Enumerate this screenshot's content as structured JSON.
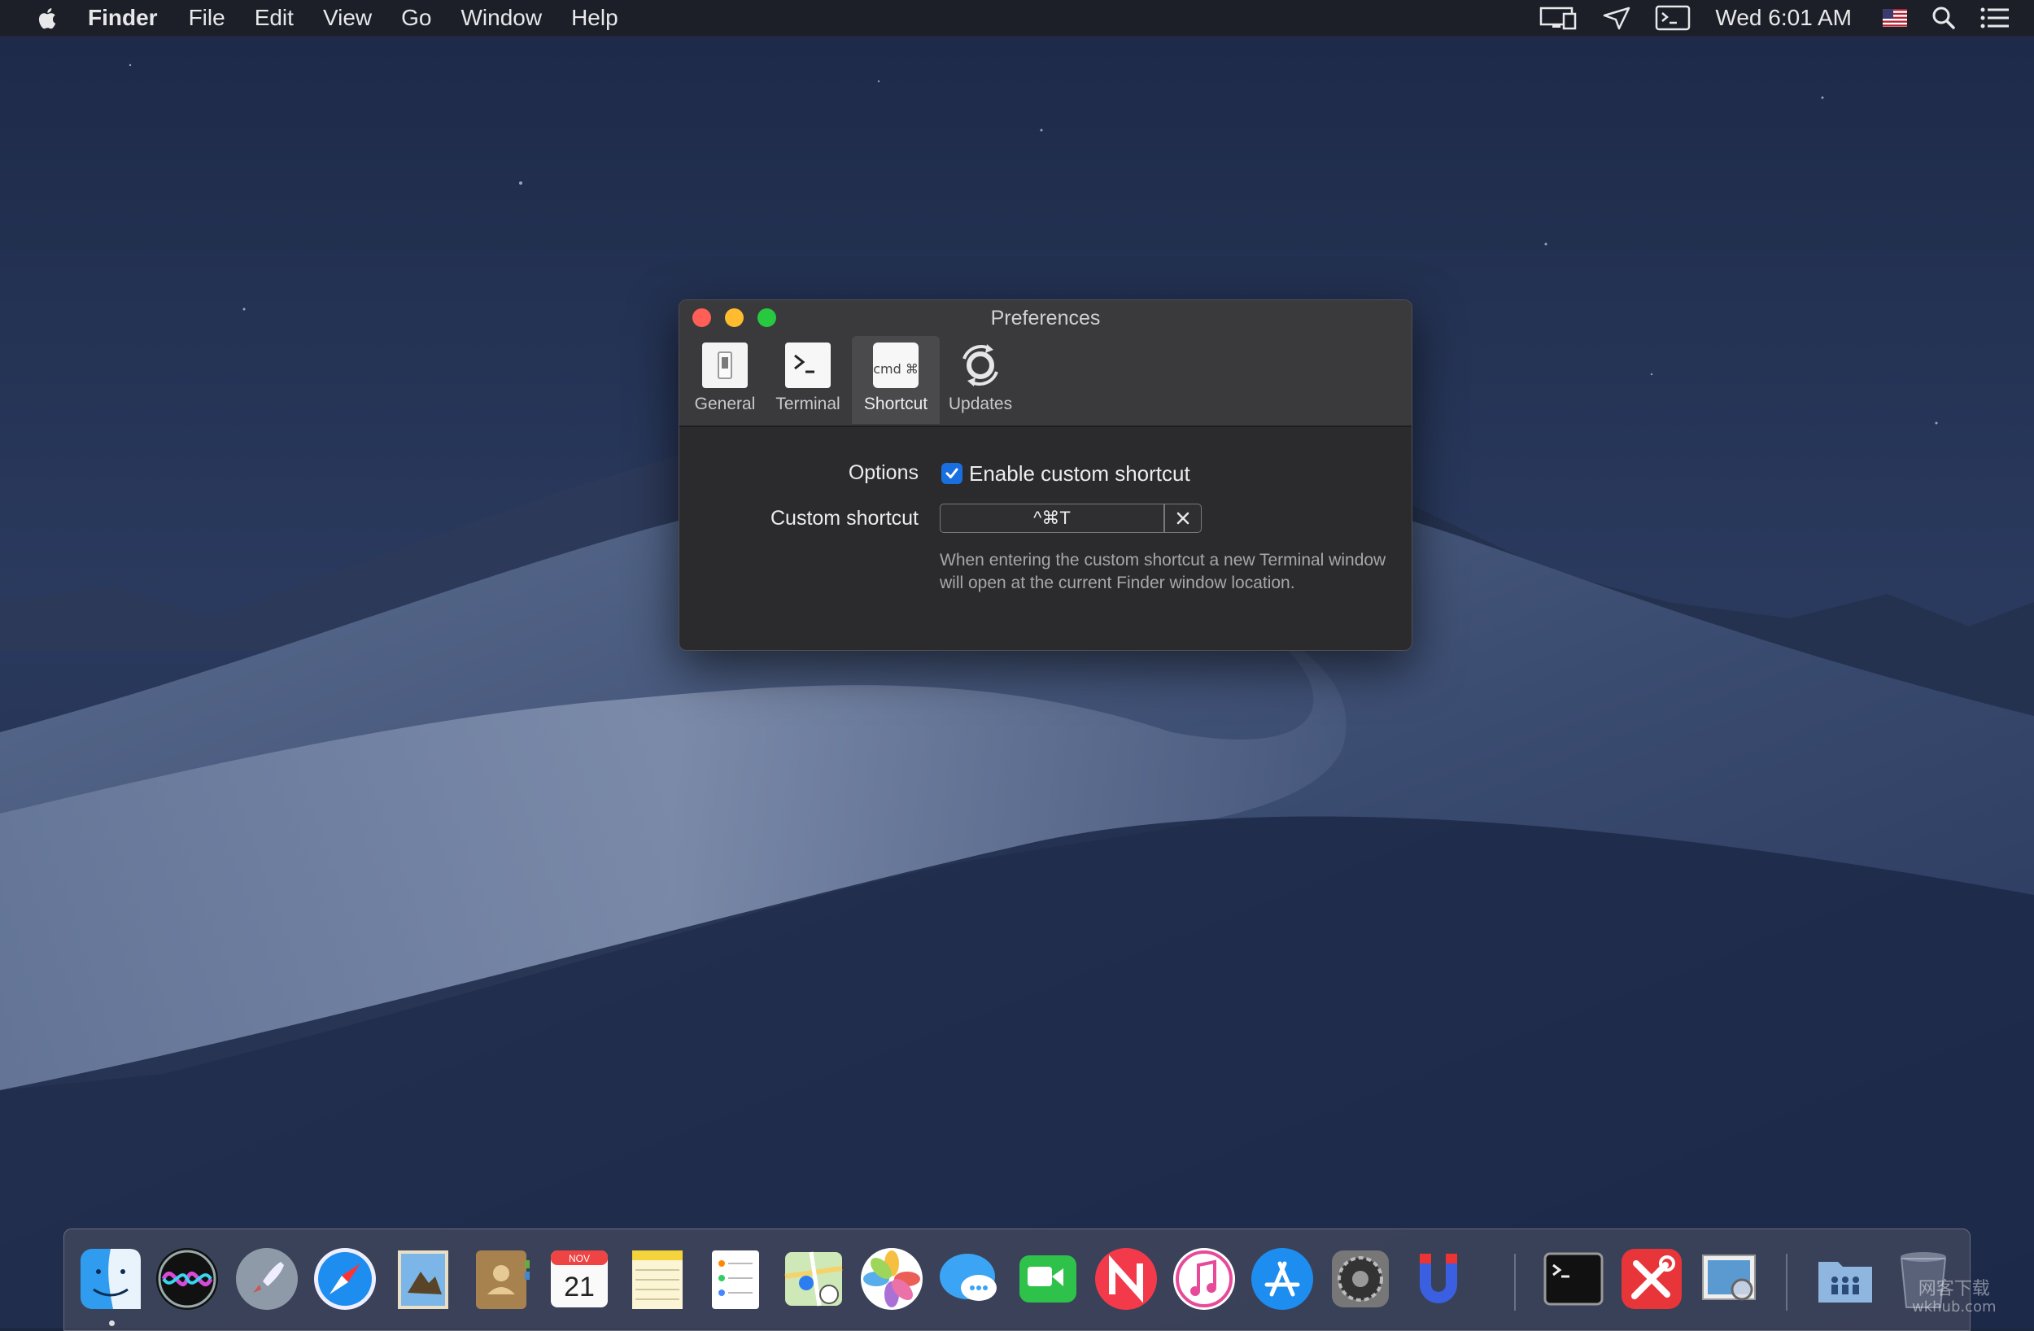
{
  "menubar": {
    "app_name": "Finder",
    "items": [
      "File",
      "Edit",
      "View",
      "Go",
      "Window",
      "Help"
    ],
    "clock": "Wed 6:01 AM",
    "status_icons": [
      "display-icon",
      "send-icon",
      "terminal-icon",
      "flag-us-icon",
      "spotlight-icon",
      "notification-center-icon"
    ]
  },
  "window": {
    "title": "Preferences",
    "tabs": [
      {
        "label": "General",
        "icon": "switch-icon"
      },
      {
        "label": "Terminal",
        "icon": "terminal-icon"
      },
      {
        "label": "Shortcut",
        "icon": "cmd-key-icon",
        "selected": true
      },
      {
        "label": "Updates",
        "icon": "refresh-icon"
      }
    ],
    "cmd_icon_text": "cmd ⌘",
    "options_label": "Options",
    "checkbox_label": "Enable custom shortcut",
    "checkbox_checked": true,
    "custom_shortcut_label": "Custom shortcut",
    "shortcut_value": "^⌘T",
    "help_text": "When entering the custom shortcut a new Terminal window will open at the current Finder window location."
  },
  "dock": {
    "apps": [
      "finder-icon",
      "siri-icon",
      "launchpad-icon",
      "safari-icon",
      "mail-icon",
      "contacts-icon",
      "calendar-icon",
      "notes-icon",
      "reminders-icon",
      "maps-icon",
      "photos-icon",
      "messages-icon",
      "facetime-icon",
      "news-icon",
      "itunes-icon",
      "app-store-icon",
      "system-preferences-icon",
      "magnet-icon",
      "terminal-icon",
      "utility-tools-icon",
      "preview-icon",
      "shared-folder-icon",
      "trash-icon"
    ],
    "calendar_month": "NOV",
    "calendar_day": "21"
  },
  "watermark": {
    "line1": "网客下载",
    "line2": "wkhub.com"
  },
  "colors": {
    "accent": "#1a6fe0",
    "close": "#ff5f57",
    "minimize": "#febc2e",
    "zoom": "#28c840"
  }
}
